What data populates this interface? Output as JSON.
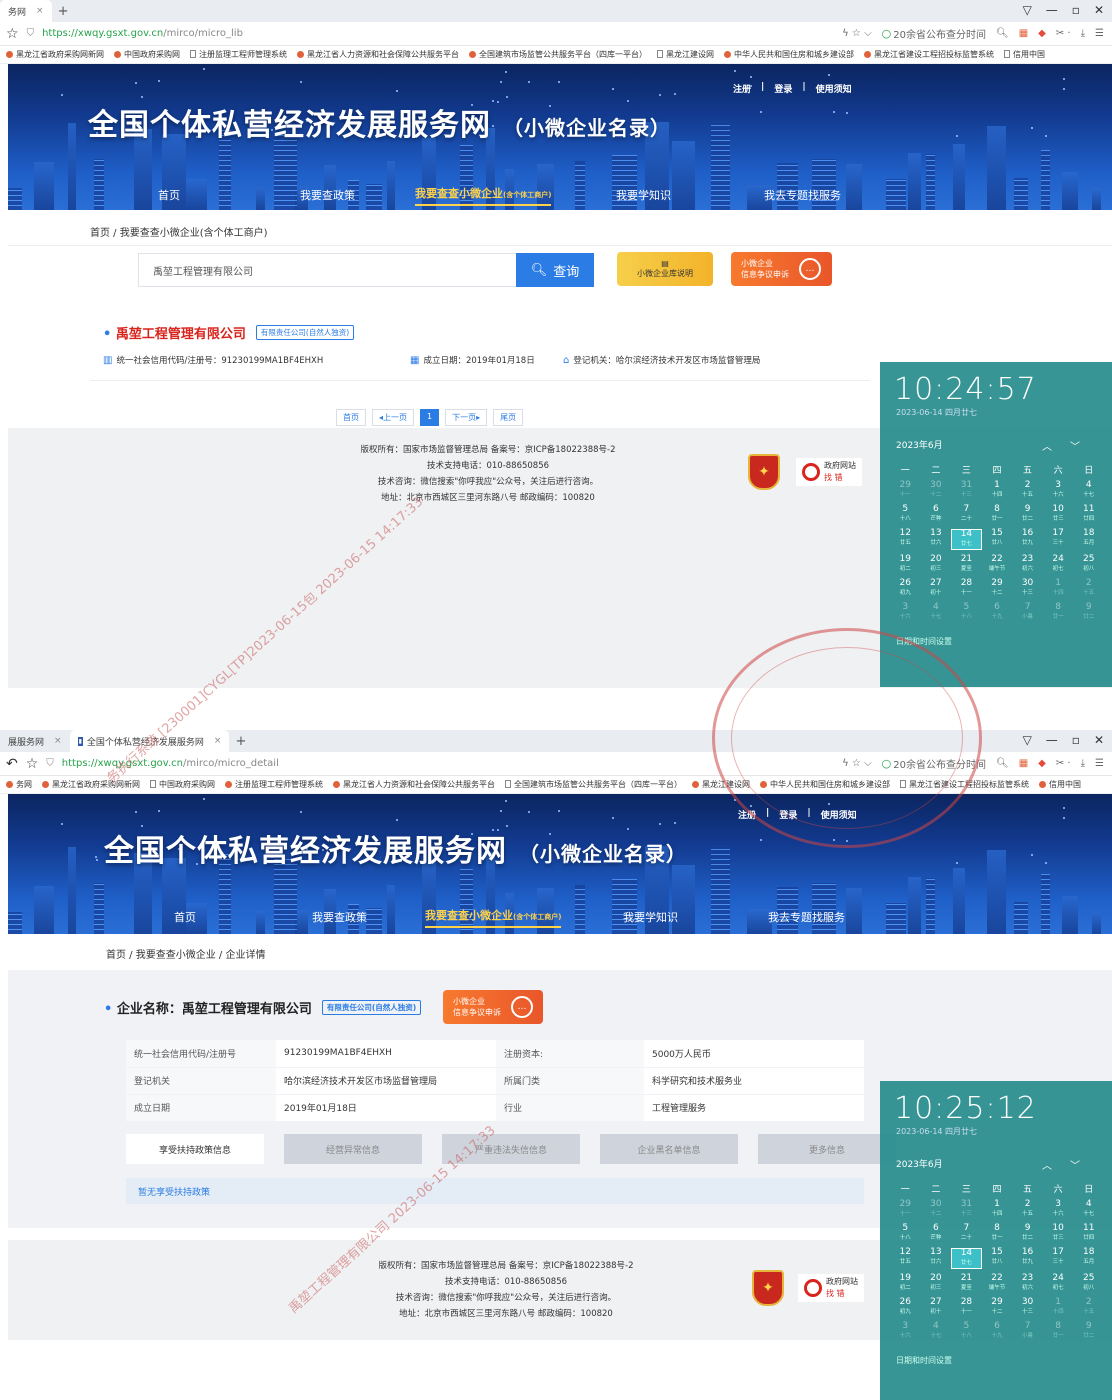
{
  "browser": {
    "top": {
      "tabs": [
        {
          "label": "务网",
          "active": true
        }
      ],
      "url_host": "https://xwqy.gsxt.gov.cn",
      "url_path": "/mirco/micro_lib",
      "search_hint": "20余省公布查分时间"
    },
    "bottom": {
      "tabs": [
        {
          "label": "展服务网",
          "active": false
        },
        {
          "label": "全国个体私营经济发展服务网",
          "active": true
        }
      ],
      "url_host": "https://xwqy.gsxt.gov.cn",
      "url_path": "/mirco/micro_detail",
      "search_hint": "20余省公布查分时间"
    },
    "bookmarks": [
      "黑龙江省政府采购网新网",
      "中国政府采购网",
      "注册监理工程师管理系统",
      "黑龙江省人力资源和社会保障公共服务平台",
      "全国建筑市场监管公共服务平台（四库一平台）",
      "黑龙江建设网",
      "中华人民共和国住房和城乡建设部",
      "黑龙江省建设工程招投标监管系统",
      "信用中国"
    ],
    "bookmarks_bottom": [
      "务网",
      "黑龙江省政府采购网新网",
      "中国政府采购网",
      "注册监理工程师管理系统",
      "黑龙江省人力资源和社会保障公共服务平台",
      "全国建筑市场监管公共服务平台（四库一平台）",
      "黑龙江建设网",
      "中华人民共和国住房和城乡建设部",
      "黑龙江省建设工程招投标监管系统",
      "信用中国"
    ]
  },
  "site": {
    "title": "全国个体私营经济发展服务网",
    "subtitle": "（小微企业名录）",
    "top_links": [
      "注册",
      "|",
      "登录",
      "|",
      "使用须知"
    ],
    "nav": {
      "home": "首页",
      "policy": "我要查政策",
      "query": "我要查查小微企业",
      "query_sub": "(含个体工商户)",
      "learn": "我要学知识",
      "service": "我去专题找服务"
    }
  },
  "list_page": {
    "breadcrumb": "首页 / 我要查查小微企业(含个体工商户)",
    "search_value": "禹堃工程管理有限公司",
    "search_button": "查询",
    "card_yellow": "小微企业库说明",
    "card_red_line1": "小微企业",
    "card_red_line2": "信息争议申诉",
    "company_name": "禹堃工程管理有限公司",
    "company_tag": "有限责任公司(自然人独资)",
    "credit_code": "统一社会信用代码/注册号：91230199MA1BF4EHXH",
    "established": "成立日期：2019年01月18日",
    "authority": "登记机关：哈尔滨经济技术开发区市场监督管理局",
    "pager": {
      "first": "首页",
      "prev": "◂上一页",
      "current": "1",
      "next": "下一页▸",
      "last": "尾页"
    }
  },
  "footer": {
    "line1": "版权所有：国家市场监督管理总局 备案号：京ICP备18022388号-2",
    "line2": "技术支持电话：010-88650856",
    "line3": "技术咨询：微信搜索\"你呼我应\"公众号，关注后进行咨询。",
    "line4": "地址：北京市西城区三里河东路八号 邮政编码：100820",
    "badge_text": "党政机关",
    "gov_label": "政府网站",
    "gov_sub": "找 错"
  },
  "detail_page": {
    "breadcrumb": "首页 / 我要查查小微企业 / 企业详情",
    "name_prefix": "企业名称：",
    "company_name": "禹堃工程管理有限公司",
    "company_tag": "有限责任公司(自然人独资)",
    "card_red_line1": "小微企业",
    "card_red_line2": "信息争议申诉",
    "rows": [
      {
        "k1": "统一社会信用代码/注册号",
        "v1": "91230199MA1BF4EHXH",
        "k2": "注册资本:",
        "v2": "5000万人民币"
      },
      {
        "k1": "登记机关",
        "v1": "哈尔滨经济技术开发区市场监督管理局",
        "k2": "所属门类",
        "v2": "科学研究和技术服务业"
      },
      {
        "k1": "成立日期",
        "v1": "2019年01月18日",
        "k2": "行业",
        "v2": "工程管理服务"
      }
    ],
    "tabs": [
      "享受扶持政策信息",
      "经营异常信息",
      "严重违法失信信息",
      "企业黑名单信息",
      "更多信息"
    ],
    "empty": "暂无享受扶持政策"
  },
  "clock_top": {
    "time": "10:24:57",
    "date": "2023-06-14 四月廿七"
  },
  "clock_bottom": {
    "time": "10:25:12",
    "date": "2023-06-14 四月廿七"
  },
  "calendar": {
    "month": "2023年6月",
    "weekdays": [
      "一",
      "二",
      "三",
      "四",
      "五",
      "六",
      "日"
    ],
    "days": [
      [
        "29",
        "十一",
        1
      ],
      [
        "30",
        "十二",
        1
      ],
      [
        "31",
        "十三",
        1
      ],
      [
        "1",
        "十四",
        0
      ],
      [
        "2",
        "十五",
        0
      ],
      [
        "3",
        "十六",
        0
      ],
      [
        "4",
        "十七",
        0
      ],
      [
        "5",
        "十八",
        0
      ],
      [
        "6",
        "芒种",
        0
      ],
      [
        "7",
        "二十",
        0
      ],
      [
        "8",
        "廿一",
        0
      ],
      [
        "9",
        "廿二",
        0
      ],
      [
        "10",
        "廿三",
        0
      ],
      [
        "11",
        "廿四",
        0
      ],
      [
        "12",
        "廿五",
        0
      ],
      [
        "13",
        "廿六",
        0
      ],
      [
        "14",
        "廿七",
        2
      ],
      [
        "15",
        "廿八",
        0
      ],
      [
        "16",
        "廿九",
        0
      ],
      [
        "17",
        "三十",
        0
      ],
      [
        "18",
        "五月",
        0
      ],
      [
        "19",
        "初二",
        0
      ],
      [
        "20",
        "初三",
        0
      ],
      [
        "21",
        "夏至",
        0
      ],
      [
        "22",
        "端午节",
        0
      ],
      [
        "23",
        "初六",
        0
      ],
      [
        "24",
        "初七",
        0
      ],
      [
        "25",
        "初八",
        0
      ],
      [
        "26",
        "初九",
        0
      ],
      [
        "27",
        "初十",
        0
      ],
      [
        "28",
        "十一",
        0
      ],
      [
        "29",
        "十二",
        0
      ],
      [
        "30",
        "十三",
        0
      ],
      [
        "1",
        "十四",
        1
      ],
      [
        "2",
        "十五",
        1
      ],
      [
        "3",
        "十六",
        1
      ],
      [
        "4",
        "十七",
        1
      ],
      [
        "5",
        "十八",
        1
      ],
      [
        "6",
        "十九",
        1
      ],
      [
        "7",
        "小暑",
        1
      ],
      [
        "8",
        "廿一",
        1
      ],
      [
        "9",
        "廿二",
        1
      ]
    ],
    "settings": "日期和时间设置"
  },
  "watermark": {
    "text1": "务执行系统 [230001]CYGL[TP]2023-06-15包 2023-06-15 14:17:33",
    "text2": "禹堃工程管理有限公司 2023-06-15 14:17:33"
  }
}
